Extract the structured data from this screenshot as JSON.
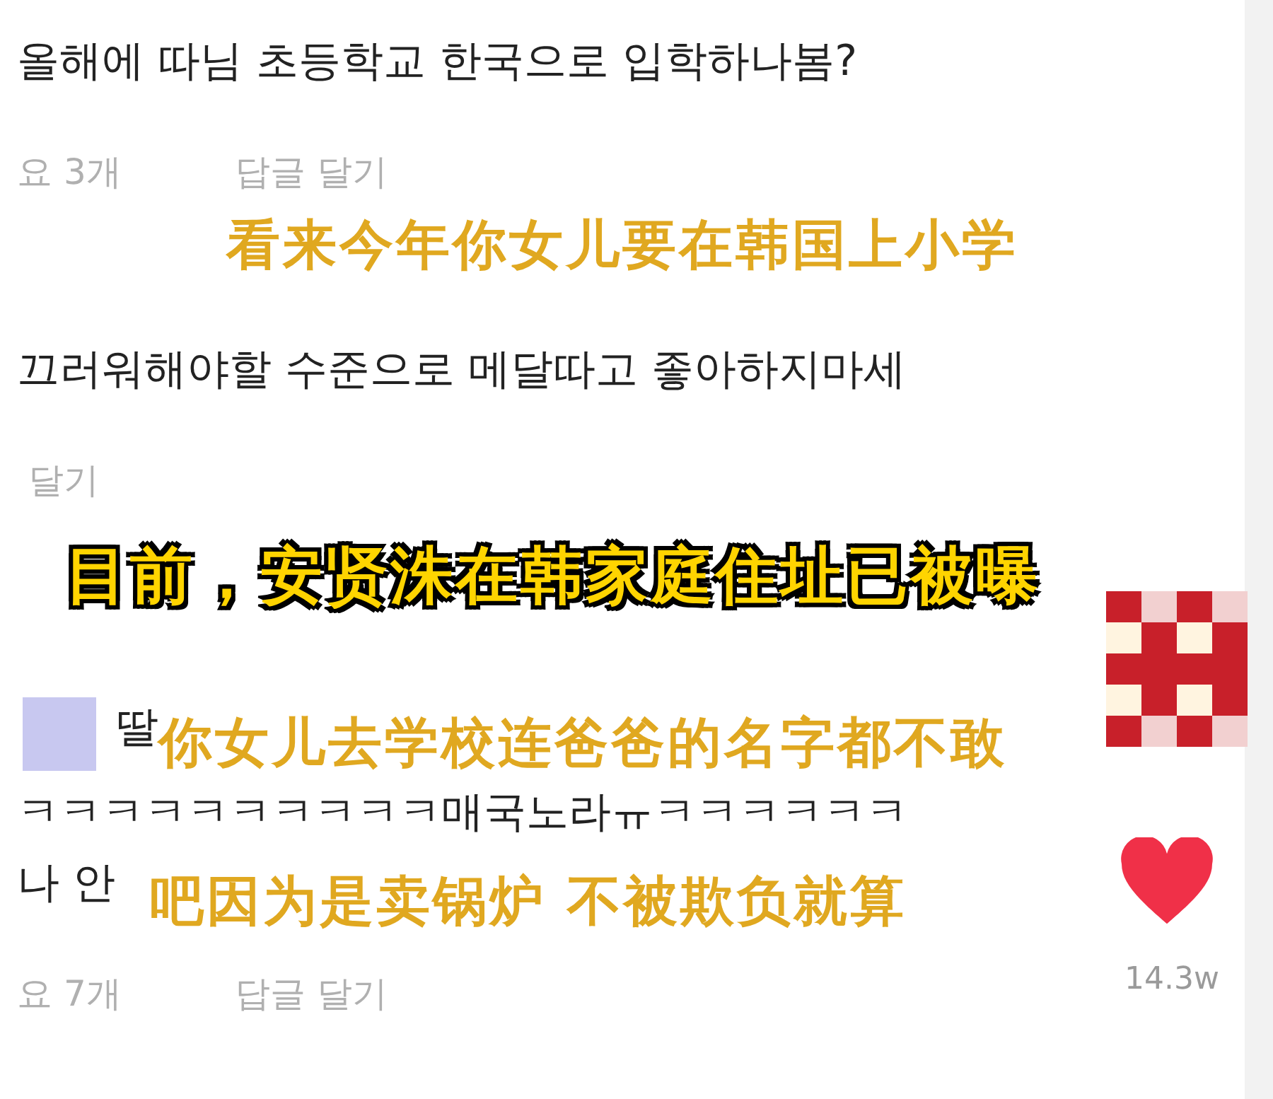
{
  "comments": [
    {
      "text": "올해에 따님 초등학교 한국으로 입학하나봄?",
      "likes": "요 3개",
      "reply": "답글 달기"
    },
    {
      "text": "끄러워해야할 수준으로 메달따고 좋아하지마세",
      "reply": "달기"
    },
    {
      "author": "딸",
      "lines": [
        "ㅋㅋㅋㅋㅋㅋㅋㅋㅋㅋ매국노라ㅠㅋㅋㅋㅋㅋㅋ",
        "나 안"
      ],
      "likes": "요 7개",
      "reply": "답글 달기"
    }
  ],
  "captions": [
    {
      "text": "看来今年你女儿要在韩国上小学",
      "kind": "soft"
    },
    {
      "text": "目前，安贤洙在韩家庭住址已被曝",
      "kind": "bold"
    },
    {
      "text": "你女儿去学校连爸爸的名字都不敢",
      "kind": "soft"
    },
    {
      "text": "吧因为是卖锅炉 不被欺负就算",
      "kind": "soft"
    }
  ],
  "view_count": "14.3w"
}
